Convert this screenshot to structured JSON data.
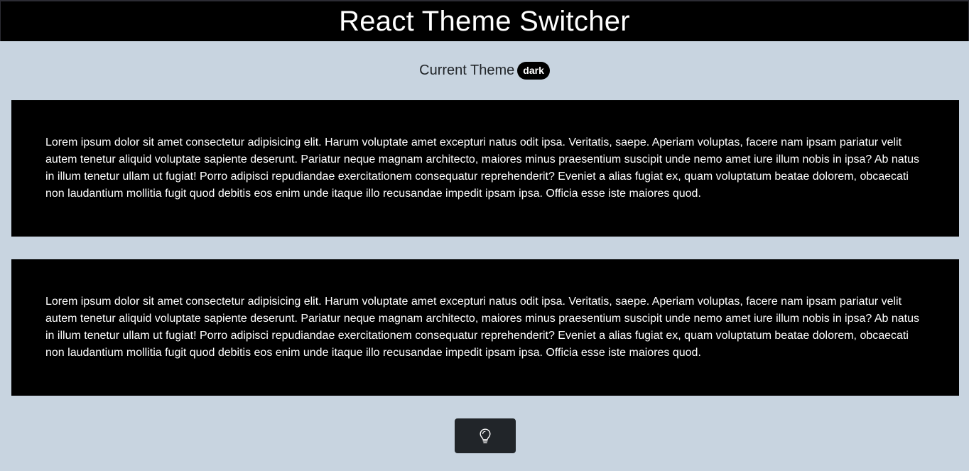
{
  "header": {
    "title": "React Theme Switcher"
  },
  "theme": {
    "label": "Current Theme",
    "value": "dark"
  },
  "cards": [
    {
      "text": "Lorem ipsum dolor sit amet consectetur adipisicing elit. Harum voluptate amet excepturi natus odit ipsa. Veritatis, saepe. Aperiam voluptas, facere nam ipsam pariatur velit autem tenetur aliquid voluptate sapiente deserunt. Pariatur neque magnam architecto, maiores minus praesentium suscipit unde nemo amet iure illum nobis in ipsa? Ab natus in illum tenetur ullam ut fugiat! Porro adipisci repudiandae exercitationem consequatur reprehenderit? Eveniet a alias fugiat ex, quam voluptatum beatae dolorem, obcaecati non laudantium mollitia fugit quod debitis eos enim unde itaque illo recusandae impedit ipsam ipsa. Officia esse iste maiores quod."
    },
    {
      "text": "Lorem ipsum dolor sit amet consectetur adipisicing elit. Harum voluptate amet excepturi natus odit ipsa. Veritatis, saepe. Aperiam voluptas, facere nam ipsam pariatur velit autem tenetur aliquid voluptate sapiente deserunt. Pariatur neque magnam architecto, maiores minus praesentium suscipit unde nemo amet iure illum nobis in ipsa? Ab natus in illum tenetur ullam ut fugiat! Porro adipisci repudiandae exercitationem consequatur reprehenderit? Eveniet a alias fugiat ex, quam voluptatum beatae dolorem, obcaecati non laudantium mollitia fugit quod debitis eos enim unde itaque illo recusandae impedit ipsam ipsa. Officia esse iste maiores quod."
    }
  ],
  "toggle": {
    "icon": "lightbulb-icon"
  },
  "colors": {
    "page_background": "#c8d4e0",
    "header_background": "#000000",
    "card_background": "#000000",
    "badge_background": "#000000",
    "button_background": "#212529",
    "text_light": "#ffffff",
    "text_dark": "#212529"
  }
}
